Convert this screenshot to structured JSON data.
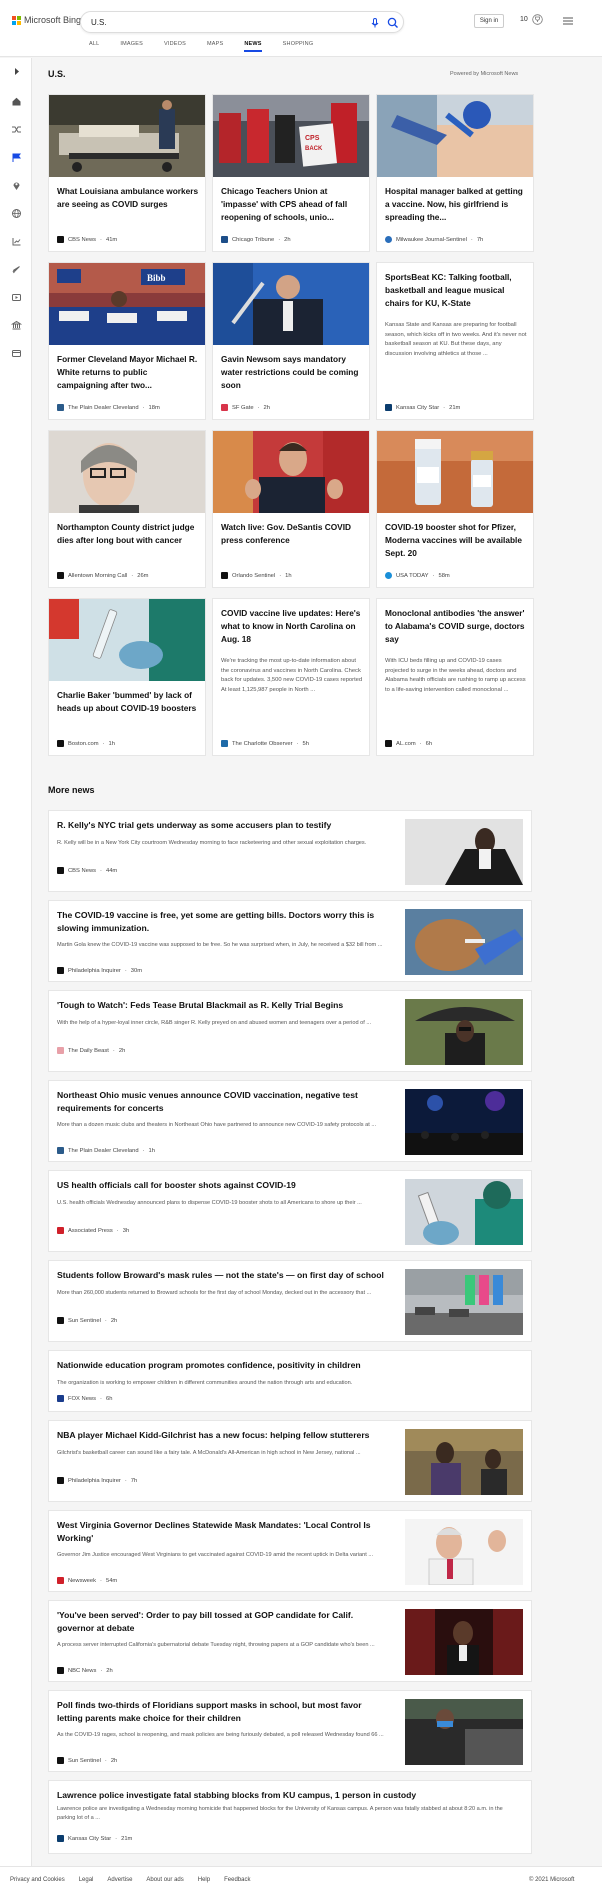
{
  "header": {
    "brand": "Microsoft Bing",
    "search_value": "U.S.",
    "signin": "Sign in",
    "rewards_count": "10"
  },
  "tabs": [
    {
      "label": "ALL"
    },
    {
      "label": "IMAGES"
    },
    {
      "label": "VIDEOS"
    },
    {
      "label": "MAPS"
    },
    {
      "label": "NEWS",
      "active": true
    },
    {
      "label": "SHOPPING"
    }
  ],
  "section_title": "U.S.",
  "powered_by": "Powered by Microsoft News",
  "cards": [
    {
      "title": "What Louisiana ambulance workers are seeing as COVID surges",
      "source": "CBS News",
      "age": "41m",
      "fav": "#111111"
    },
    {
      "title": "Chicago Teachers Union at 'impasse' with CPS ahead of fall reopening of schools, unio...",
      "source": "Chicago Tribune",
      "age": "2h",
      "fav": "#1d4e89"
    },
    {
      "title": "Hospital manager balked at getting a vaccine. Now, his girlfriend is spreading the...",
      "source": "Milwaukee Journal-Sentinel",
      "age": "7h",
      "fav": "#2a6ebb"
    },
    {
      "title": "Former Cleveland Mayor Michael R. White returns to public campaigning after two...",
      "source": "The Plain Dealer Cleveland",
      "age": "18m",
      "fav": "#2b5b8a"
    },
    {
      "title": "Gavin Newsom says mandatory water restrictions could be coming soon",
      "source": "SF Gate",
      "age": "2h",
      "fav": "#d8344a"
    },
    {
      "title": "SportsBeat KC: Talking football, basketball and league musical chairs for KU, K-State",
      "snippet": "Kansas State and Kansas are preparing for football season, which kicks off in two weeks. And it's never not basketball season at KU. But these days, any discussion involving athletics at those ...",
      "source": "Kansas City Star",
      "age": "21m",
      "fav": "#0b3d6e"
    },
    {
      "title": "Northampton County district judge dies after long bout with cancer",
      "source": "Allentown Morning Call",
      "age": "26m",
      "fav": "#111111"
    },
    {
      "title": "Watch live: Gov. DeSantis COVID press conference",
      "source": "Orlando Sentinel",
      "age": "1h",
      "fav": "#111111"
    },
    {
      "title": "COVID-19 booster shot for Pfizer, Moderna vaccines will be available Sept. 20",
      "source": "USA TODAY",
      "age": "58m",
      "fav": "#1a8fd8"
    },
    {
      "title": "Charlie Baker 'bummed' by lack of heads up about COVID-19 boosters",
      "source": "Boston.com",
      "age": "1h",
      "fav": "#111111"
    },
    {
      "title": "COVID vaccine live updates: Here's what to know in North Carolina on Aug. 18",
      "snippet": "We're tracking the most up-to-date information about the coronavirus and vaccines in North Carolina. Check back for updates. 3,500 new COVID-19 cases reported At least 1,125,987 people in North ...",
      "source": "The Charlotte Observer",
      "age": "5h",
      "fav": "#1e6aa8"
    },
    {
      "title": "Monoclonal antibodies 'the answer' to Alabama's COVID surge, doctors say",
      "snippet": "With ICU beds filling up and COVID-19 cases projected to surge in the weeks ahead, doctors and Alabama health officials are rushing to ramp up access to a life-saving intervention called monoclonal ...",
      "source": "AL.com",
      "age": "6h",
      "fav": "#111111"
    }
  ],
  "more_news_title": "More news",
  "more_news": [
    {
      "title": "R. Kelly's NYC trial gets underway as some accusers plan to testify",
      "snippet": "R. Kelly will be in a New York City courtroom Wednesday morning to face racketeering and other sexual exploitation charges.",
      "source": "CBS News",
      "age": "44m",
      "fav": "#111111"
    },
    {
      "title": "The COVID-19 vaccine is free, yet some are getting bills. Doctors worry this is slowing immunization.",
      "snippet": "Martin Gola knew the COVID-19 vaccine was supposed to be free. So he was surprised when, in July, he received a $32 bill from ...",
      "source": "Philadelphia Inquirer",
      "age": "30m",
      "fav": "#111111"
    },
    {
      "title": "'Tough to Watch': Feds Tease Brutal Blackmail as R. Kelly Trial Begins",
      "snippet": "With the help of a hyper-loyal inner circle, R&B singer R. Kelly preyed on and abused women and teenagers over a period of ...",
      "source": "The Daily Beast",
      "age": "2h",
      "fav": "#e8a0a8"
    },
    {
      "title": "Northeast Ohio music venues announce COVID vaccination, negative test requirements for concerts",
      "snippet": "More than a dozen music clubs and theaters in Northeast Ohio have partnered to announce new COVID-19 safety protocols at ...",
      "source": "The Plain Dealer Cleveland",
      "age": "1h",
      "fav": "#2b5b8a"
    },
    {
      "title": "US health officials call for booster shots against COVID-19",
      "snippet": "U.S. health officials Wednesday announced plans to dispense COVID-19 booster shots to all Americans to shore up their ...",
      "source": "Associated Press",
      "age": "3h",
      "fav": "#d0202a"
    },
    {
      "title": "Students follow Broward's mask rules — not the state's — on first day of school",
      "snippet": "More than 260,000 students returned to Broward schools for the first day of school Monday, decked out in the accessory that ...",
      "source": "Sun Sentinel",
      "age": "2h",
      "fav": "#111111"
    },
    {
      "title": "Nationwide education program promotes confidence, positivity in children",
      "snippet": "The organization is working to empower children in different communities around the nation through arts and education.",
      "source": "FOX News",
      "age": "6h",
      "fav": "#1a3c8c"
    },
    {
      "title": "NBA player Michael Kidd-Gilchrist has a new focus: helping fellow stutterers",
      "snippet": "Gilchrist's basketball career can sound like a fairy tale. A McDonald's All-American in high school in New Jersey, national ...",
      "source": "Philadelphia Inquirer",
      "age": "7h",
      "fav": "#111111"
    },
    {
      "title": "West Virginia Governor Declines Statewide Mask Mandates: 'Local Control Is Working'",
      "snippet": "Governor Jim Justice encouraged West Virginians to get vaccinated against COVID-19 amid the recent uptick in Delta variant ...",
      "source": "Newsweek",
      "age": "54m",
      "fav": "#d0202a"
    },
    {
      "title": "'You've been served': Order to pay bill tossed at GOP candidate for Calif. governor at debate",
      "snippet": "A process server interrupted California's gubernatorial debate Tuesday night, throwing papers at a GOP candidate who's been ...",
      "source": "NBC News",
      "age": "2h",
      "fav": "#111111"
    },
    {
      "title": "Poll finds two-thirds of Floridians support masks in school, but most favor letting parents make choice for their children",
      "snippet": "As the COVID-19 rages, school is reopening, and mask policies are being furiously debated, a poll released Wednesday found 66 ...",
      "source": "Sun Sentinel",
      "age": "2h",
      "fav": "#111111"
    },
    {
      "title": "Lawrence police investigate fatal stabbing blocks from KU campus, 1 person in custody",
      "snippet": "Lawrence police are investigating a Wednesday morning homicide that happened blocks for the University of Kansas campus. A person was fatally stabbed at about 8:20 a.m. in the parking lot of a ...",
      "source": "Kansas City Star",
      "age": "21m",
      "fav": "#0b3d6e"
    }
  ],
  "footer": {
    "links": [
      "Privacy and Cookies",
      "Legal",
      "Advertise",
      "About our ads",
      "Help",
      "Feedback"
    ],
    "copyright": "© 2021 Microsoft"
  },
  "colors": {
    "accent": "#174ae4",
    "logo": [
      "#f25022",
      "#7fba00",
      "#00a4ef",
      "#ffb900"
    ]
  }
}
